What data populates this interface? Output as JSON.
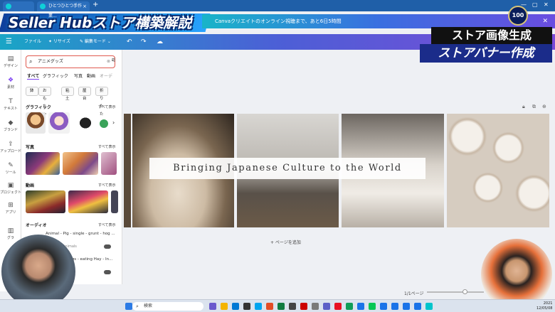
{
  "browser": {
    "tabs": [
      {
        "label": ""
      },
      {
        "label": "ひとつひとつ手作業..."
      }
    ],
    "new_tab": "+",
    "win_min": "—",
    "win_max": "▢",
    "win_close": "✕"
  },
  "overlay": {
    "hub_title": "Seller Hubストア構築解説",
    "caption_1": "ストア画像生成",
    "caption_2": "ストアバナー作成",
    "badge": "100"
  },
  "promo": {
    "text": "Canvaクリエイトのオンライン視聴まで、あと6日5時間",
    "close": "✕"
  },
  "toolbar": {
    "file": "ファイル",
    "resize": "✦ リサイズ",
    "edit_mode": "✎ 編集モード ⌄",
    "undo": "↶",
    "redo": "↷",
    "cloud": "☁"
  },
  "rail": [
    {
      "icon": "▤",
      "label": "デザイン"
    },
    {
      "icon": "❖",
      "label": "素材"
    },
    {
      "icon": "T",
      "label": "テキスト"
    },
    {
      "icon": "◆",
      "label": "ブランド"
    },
    {
      "icon": "⇪",
      "label": "アップロード"
    },
    {
      "icon": "✎",
      "label": "ツール"
    },
    {
      "icon": "▣",
      "label": "プロジェクト"
    },
    {
      "icon": "⊞",
      "label": "アプリ"
    },
    {
      "icon": "▥",
      "label": "グラ"
    }
  ],
  "panel": {
    "search_value": "アニメグッズ",
    "tabs": [
      "すべて",
      "グラフィック",
      "写真",
      "動画",
      "オーデ"
    ],
    "chips": [
      "鉢",
      "おもちゃ",
      "粘土",
      "屋台",
      "折りたた"
    ],
    "sections": {
      "graphics": {
        "title": "グラフィック",
        "more": "すべて表示"
      },
      "photos": {
        "title": "写真",
        "more": "すべて表示"
      },
      "videos": {
        "title": "動画",
        "more": "すべて表示"
      },
      "audio": {
        "title": "オーディオ",
        "more": "すべて表示"
      }
    },
    "audio_items": [
      {
        "title": "Animal - Pig - single - grunt - hog ...",
        "sub": "Animals"
      },
      {
        "title": "Pigs - eating Hay - In...",
        "sub": ""
      }
    ]
  },
  "canvas": {
    "banner_text": "Bringing Japanese Culture to the World",
    "add_page": "+ ページを追加",
    "page_count": "1/1ページ"
  },
  "taskbar": {
    "search_placeholder": "検索",
    "time": "2021",
    "date": "12/05/08"
  },
  "colors": {
    "toolbar_start": "#1aa5c6",
    "toolbar_end": "#7b4bd8",
    "search_border": "#e05a4f",
    "accent": "#7b3ff2"
  }
}
